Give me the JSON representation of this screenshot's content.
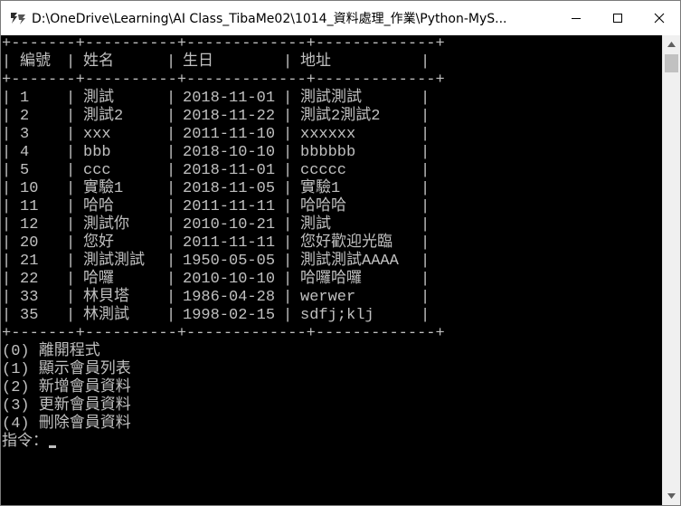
{
  "window": {
    "title": "D:\\OneDrive\\Learning\\AI Class_TibaMe02\\1014_資料處理_作業\\Python-MyS..."
  },
  "table": {
    "border": "+-------+----------+-------------+-------------+",
    "headers": [
      "編號",
      "姓名",
      "生日",
      "地址"
    ],
    "rows": [
      [
        "1",
        "測試",
        "2018-11-01",
        "測試測試"
      ],
      [
        "2",
        "測試2",
        "2018-11-22",
        "測試2測試2"
      ],
      [
        "3",
        "xxx",
        "2011-11-10",
        "xxxxxx"
      ],
      [
        "4",
        "bbb",
        "2018-10-10",
        "bbbbbb"
      ],
      [
        "5",
        "ccc",
        "2018-11-01",
        "ccccc"
      ],
      [
        "10",
        "實驗1",
        "2018-11-05",
        "實驗1"
      ],
      [
        "11",
        "哈哈",
        "2011-11-11",
        "哈哈哈"
      ],
      [
        "12",
        "測試你",
        "2010-10-21",
        "測試"
      ],
      [
        "20",
        "您好",
        "2011-11-11",
        "您好歡迎光臨"
      ],
      [
        "21",
        "測試測試",
        "1950-05-05",
        "測試測試AAAA"
      ],
      [
        "22",
        "哈囉",
        "2010-10-10",
        "哈囉哈囉"
      ],
      [
        "33",
        "林貝塔",
        "1986-04-28",
        "werwer"
      ],
      [
        "35",
        "林測試",
        "1998-02-15",
        "sdfj;klj"
      ]
    ]
  },
  "menu": [
    "(0) 離開程式",
    "(1) 顯示會員列表",
    "(2) 新增會員資料",
    "(3) 更新會員資料",
    "(4) 刪除會員資料"
  ],
  "prompt": "指令：",
  "icons": {
    "app": "console-app-icon",
    "minimize": "minimize-icon",
    "maximize": "maximize-icon",
    "close": "close-icon",
    "scroll_up": "scroll-up-arrow-icon",
    "scroll_down": "scroll-down-arrow-icon"
  },
  "colors": {
    "console_bg": "#000000",
    "console_text": "#c0c0c0",
    "titlebar_bg": "#ffffff"
  }
}
